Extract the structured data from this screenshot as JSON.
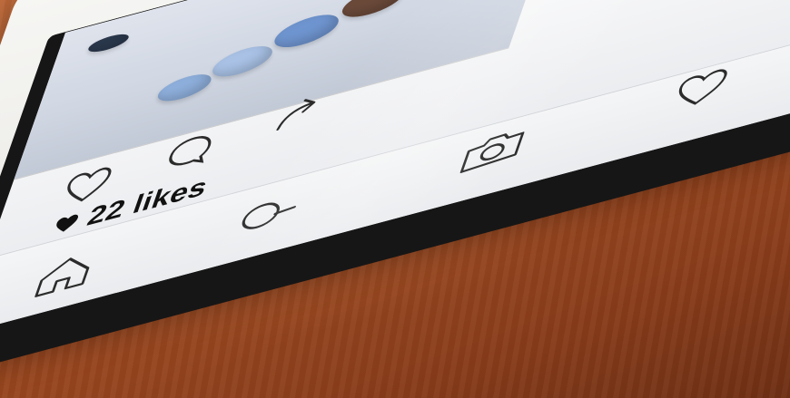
{
  "post": {
    "likes_text": "22 likes",
    "actions": [
      {
        "name": "like",
        "icon": "heart-outline-icon"
      },
      {
        "name": "comment",
        "icon": "speech-bubble-icon"
      },
      {
        "name": "share",
        "icon": "share-arrow-icon"
      }
    ]
  },
  "tab_bar": {
    "items": [
      {
        "name": "home",
        "icon": "home-icon"
      },
      {
        "name": "search",
        "icon": "search-icon"
      },
      {
        "name": "camera",
        "icon": "camera-icon"
      },
      {
        "name": "activity",
        "icon": "heart-outline-icon"
      }
    ]
  },
  "colors": {
    "table": "#a44e23",
    "tablet_frame": "#f2f1ee",
    "bezel": "#161616",
    "screen_bg": "#f1f2f4",
    "icon_stroke": "#2b2b2b",
    "pebble_blue": "#7fa2d6",
    "pebble_brown": "#6b4a3a"
  }
}
